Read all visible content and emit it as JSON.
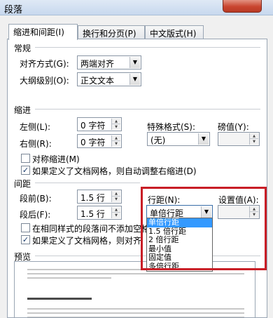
{
  "window": {
    "title": "段落",
    "close_glyph": "✕"
  },
  "tabs": [
    {
      "label": "缩进和间距(I)"
    },
    {
      "label": "换行和分页(P)"
    },
    {
      "label": "中文版式(H)"
    }
  ],
  "general": {
    "heading": "常规",
    "alignment_label": "对齐方式(G):",
    "alignment_value": "两端对齐",
    "outline_label": "大纲级别(O):",
    "outline_value": "正文文本"
  },
  "indent": {
    "heading": "缩进",
    "left_label": "左侧(L):",
    "left_value": "0 字符",
    "right_label": "右侧(R):",
    "right_value": "0 字符",
    "special_label": "特殊格式(S):",
    "special_value": "(无)",
    "by_label": "磅值(Y):",
    "mirror_label": "对称缩进(M)",
    "mirror_checked": false,
    "auto_adjust_label": "如果定义了文档网格，则自动调整右缩进(D)",
    "auto_adjust_checked": true
  },
  "spacing": {
    "heading": "间距",
    "before_label": "段前(B):",
    "before_value": "1.5 行",
    "after_label": "段后(F):",
    "after_value": "1.5 行",
    "line_spacing_label": "行距(N):",
    "line_spacing_value": "单倍行距",
    "at_label": "设置值(A):",
    "no_space_same_style_label": "在相同样式的段落间不添加空格",
    "no_space_same_style_checked": false,
    "snap_grid_label": "如果定义了文档网格，则对齐",
    "snap_grid_checked": true
  },
  "line_spacing_options": [
    "单倍行距",
    "1.5 倍行距",
    "2 倍行距",
    "最小值",
    "固定值",
    "多倍行距"
  ],
  "line_spacing_selected": "单倍行距",
  "preview": {
    "heading": "预览"
  },
  "icons": {
    "dropdown_arrow": "▼",
    "spin_up": "▲",
    "spin_down": "▼",
    "check_mark": "✓"
  },
  "colors": {
    "highlight": "#3399ff",
    "annotation_box": "#c81e26"
  }
}
